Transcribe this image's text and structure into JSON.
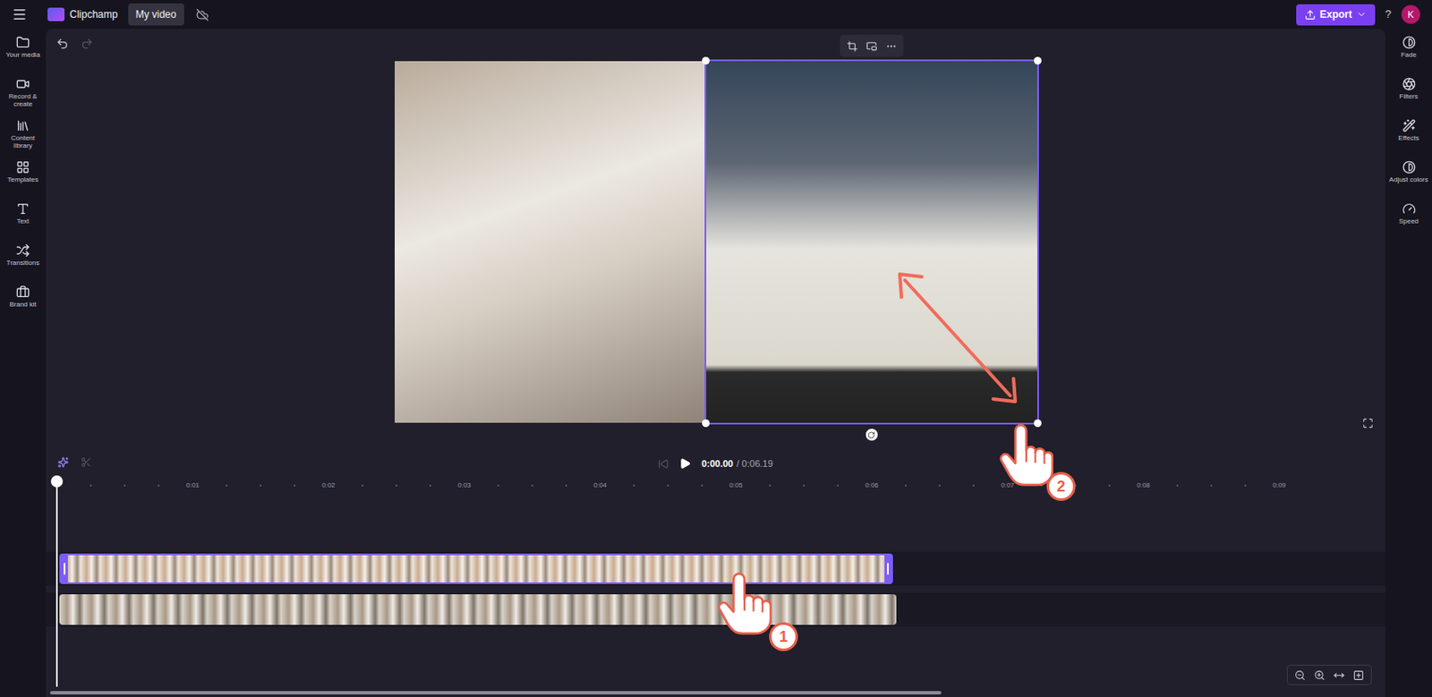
{
  "app": {
    "name": "Clipchamp",
    "project_tab": "My video",
    "export_button": "Export",
    "help": "?",
    "avatar": "K"
  },
  "left_sidebar": {
    "items": [
      {
        "label": "Your media"
      },
      {
        "label": "Record & create"
      },
      {
        "label": "Content library"
      },
      {
        "label": "Templates"
      },
      {
        "label": "Text"
      },
      {
        "label": "Transitions"
      },
      {
        "label": "Brand kit"
      }
    ]
  },
  "right_sidebar": {
    "items": [
      {
        "label": "Fade"
      },
      {
        "label": "Filters"
      },
      {
        "label": "Effects"
      },
      {
        "label": "Adjust colors"
      },
      {
        "label": "Speed"
      }
    ]
  },
  "preview": {
    "clips": [
      {
        "selected": false
      },
      {
        "selected": true
      }
    ]
  },
  "playback": {
    "current_time": "0:00.00",
    "total_time": "/ 0:06.19"
  },
  "ruler": {
    "ticks": [
      "0:01",
      "0:02",
      "0:03",
      "0:04",
      "0:05",
      "0:06",
      "0:07",
      "0:08",
      "0:09"
    ]
  },
  "tracks": [
    {
      "selected": true
    },
    {
      "selected": false
    }
  ],
  "annotations": [
    {
      "label": "1"
    },
    {
      "label": "2"
    }
  ]
}
